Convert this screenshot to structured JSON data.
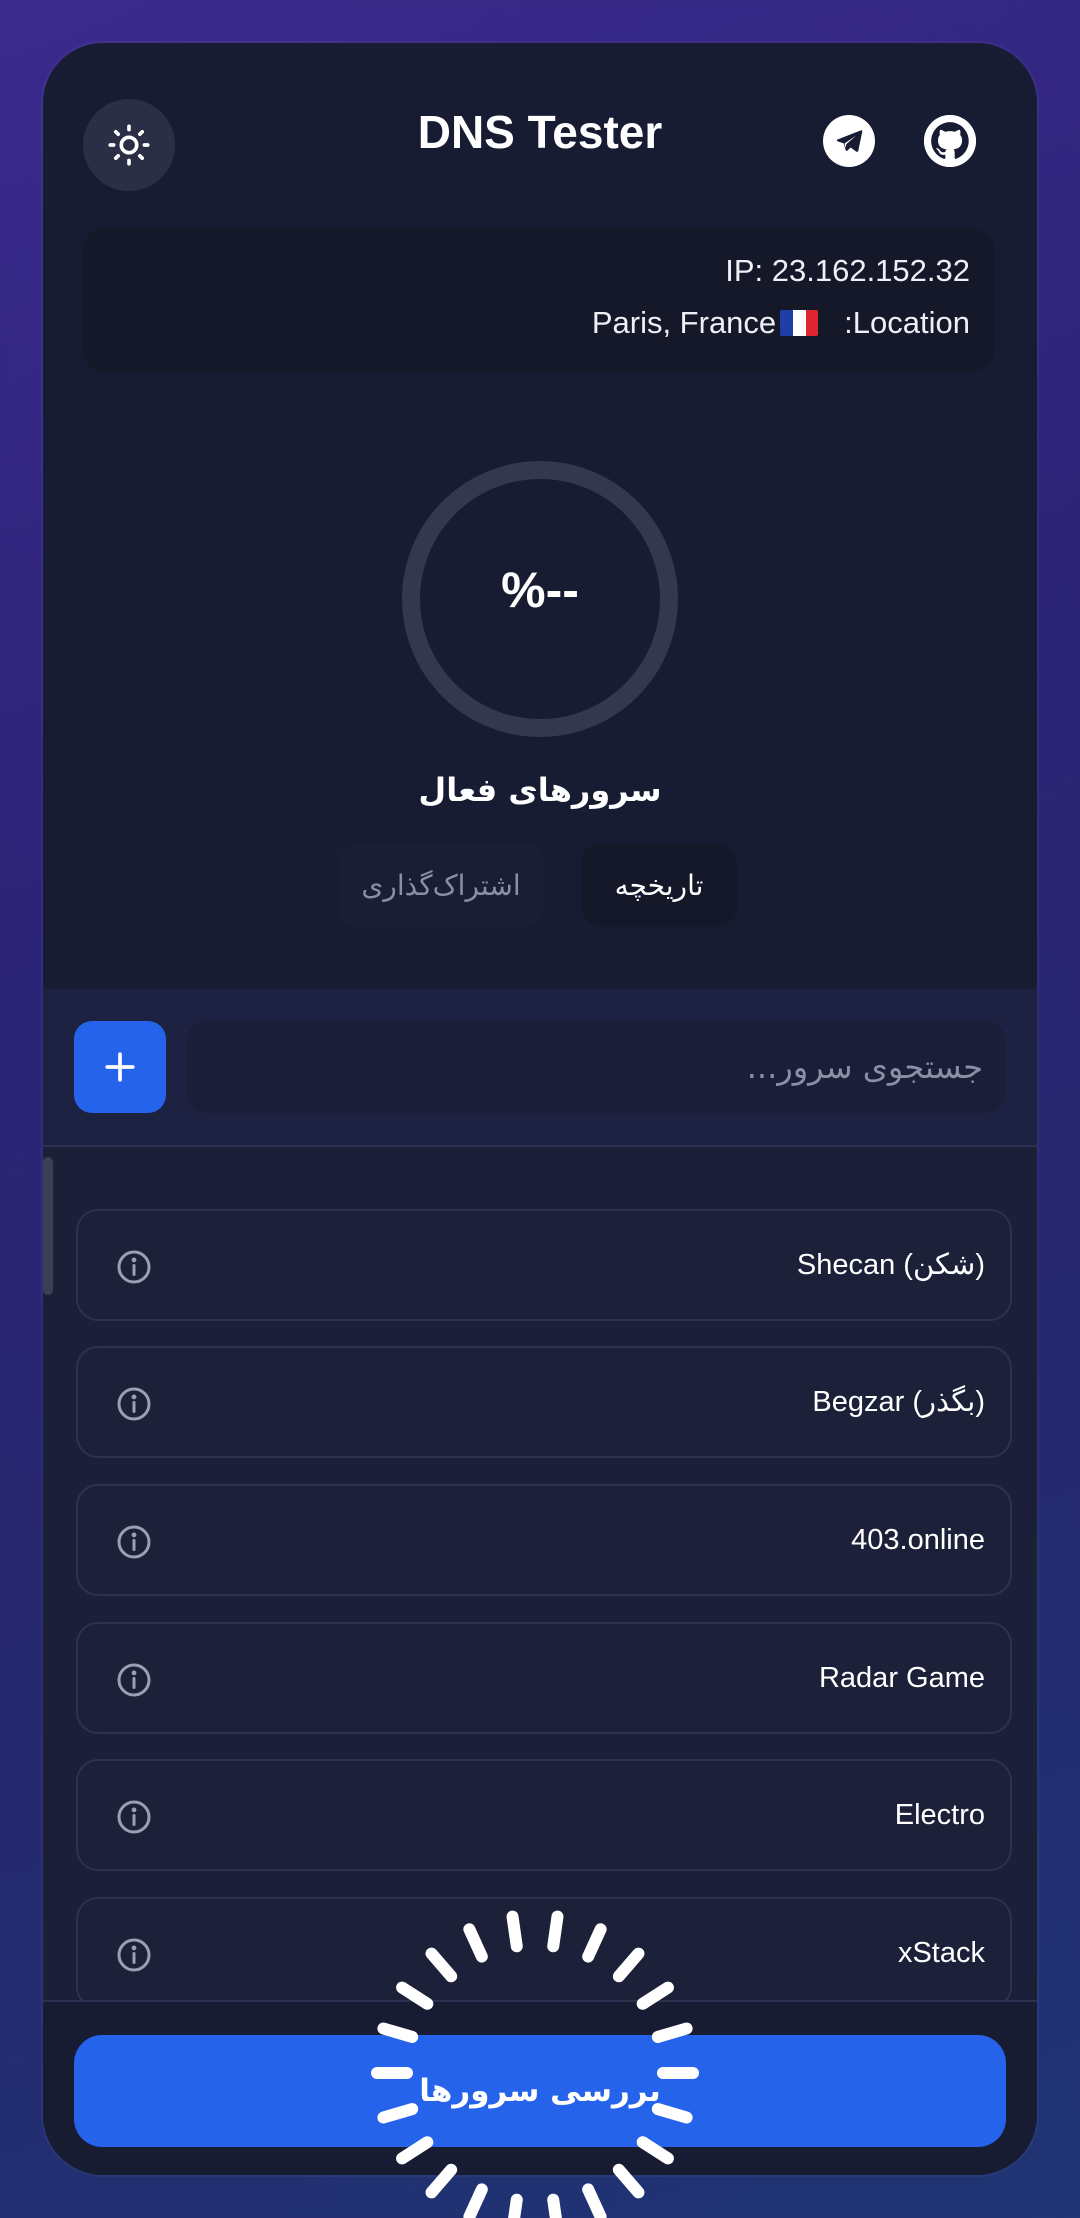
{
  "header": {
    "title": "DNS Tester",
    "theme_icon": "sun-icon",
    "telegram_icon": "telegram-icon",
    "github_icon": "github-icon"
  },
  "connection": {
    "ip_text": "IP: 23.162.152.32",
    "location_label": ":Location",
    "location_value": "Paris, France",
    "flag": "france-flag"
  },
  "gauge": {
    "value_text": "%--",
    "caption": "سرورهای فعال"
  },
  "tabs": [
    {
      "label": "تاریخچه",
      "active": true
    },
    {
      "label": "اشتراک‌گذاری",
      "active": false
    }
  ],
  "search": {
    "placeholder": "جستجوی سرور...",
    "value": "",
    "add_icon": "plus-icon"
  },
  "servers": [
    {
      "name": "Shecan (شکن)"
    },
    {
      "name": "Begzar (بگذر)"
    },
    {
      "name": "403.online"
    },
    {
      "name": "Radar Game"
    },
    {
      "name": "Electro"
    },
    {
      "name": "xStack"
    }
  ],
  "footer": {
    "check_label": "بررسی سرورها",
    "loading_icon": "spinner-icon"
  },
  "colors": {
    "accent": "#2563eb",
    "card_bg": "#181c33",
    "text": "#ffffff",
    "muted": "#8a8fa4"
  }
}
